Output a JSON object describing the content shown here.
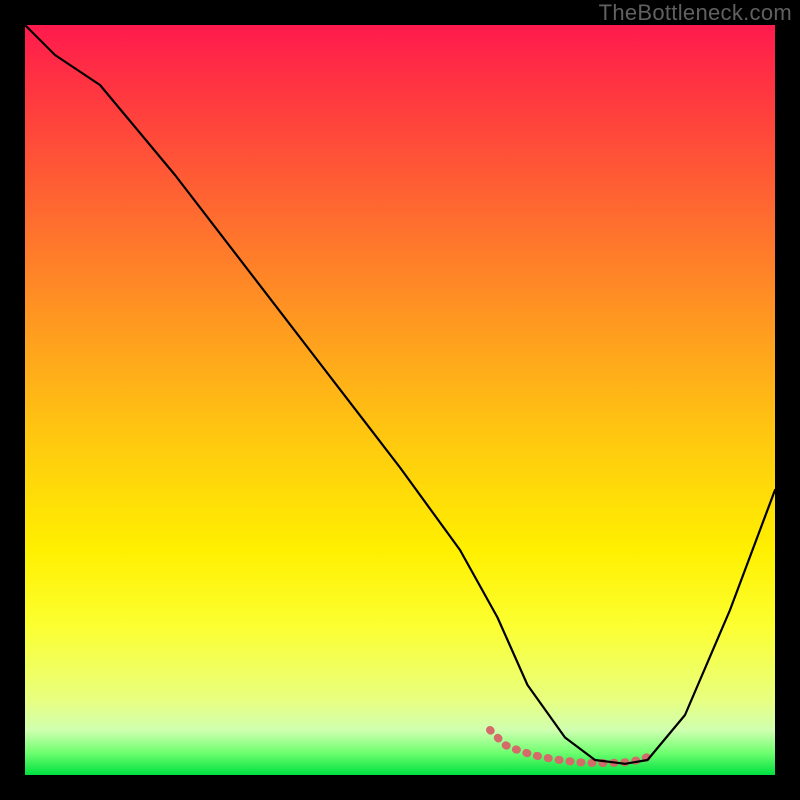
{
  "watermark": "TheBottleneck.com",
  "chart_data": {
    "type": "line",
    "title": "",
    "xlabel": "",
    "ylabel": "",
    "xlim": [
      0,
      100
    ],
    "ylim": [
      0,
      100
    ],
    "gradient_colors": {
      "top": "#ff1a4d",
      "mid_upper": "#ff9a20",
      "mid": "#fff000",
      "mid_lower": "#e8ff80",
      "bottom": "#00e040"
    },
    "series": [
      {
        "name": "bottleneck-curve",
        "color": "#000000",
        "stroke_width": 2.2,
        "x": [
          0,
          4,
          10,
          20,
          30,
          40,
          50,
          58,
          63,
          67,
          72,
          76,
          80,
          83,
          88,
          94,
          100
        ],
        "y": [
          100,
          96,
          92,
          80,
          67,
          54,
          41,
          30,
          21,
          12,
          5,
          2,
          1.5,
          2,
          8,
          22,
          38
        ]
      },
      {
        "name": "highlight-band",
        "color": "#d46a6a",
        "stroke_width": 8,
        "x": [
          62,
          64,
          66,
          68,
          70,
          72,
          74,
          76,
          78,
          80,
          82,
          84
        ],
        "y": [
          6,
          4,
          3.2,
          2.6,
          2.2,
          1.9,
          1.7,
          1.6,
          1.6,
          1.7,
          2,
          2.8
        ]
      }
    ]
  }
}
